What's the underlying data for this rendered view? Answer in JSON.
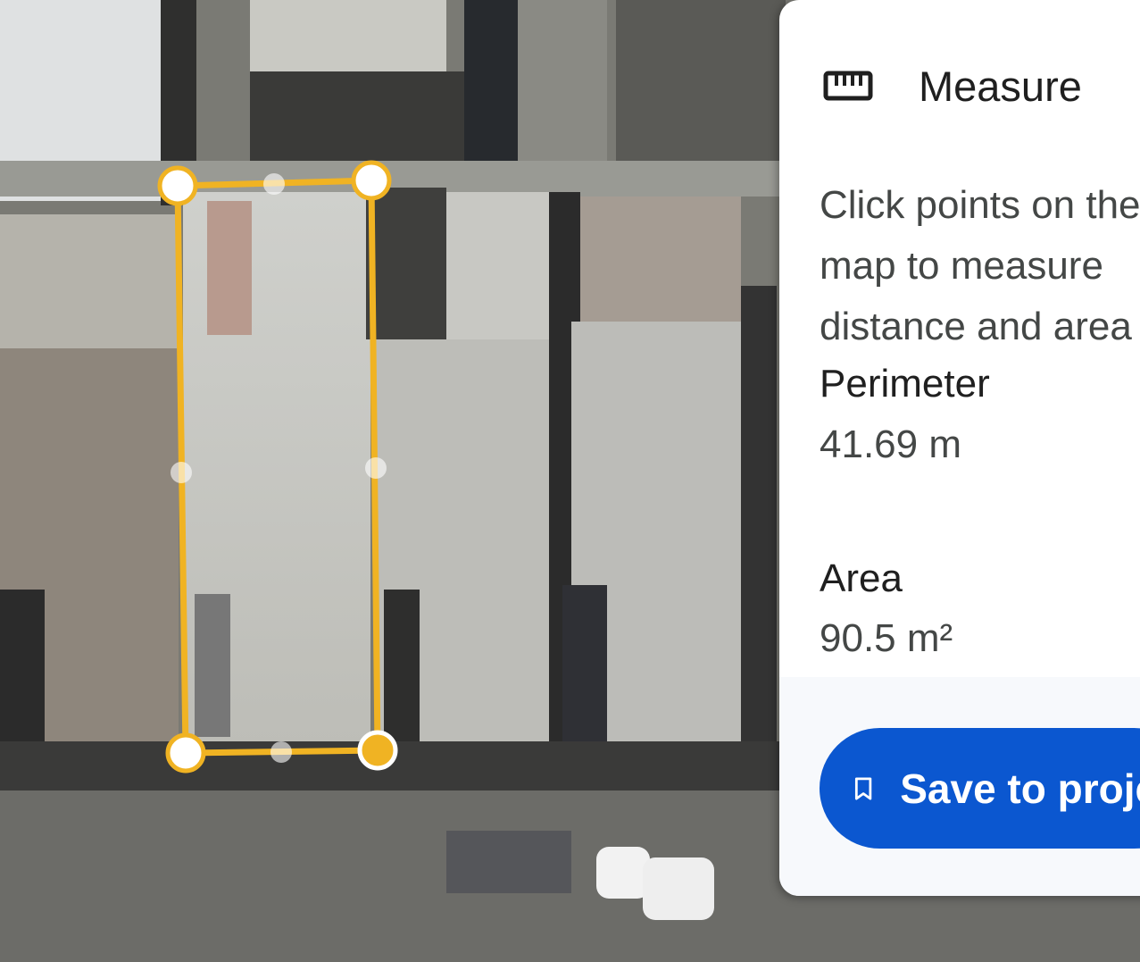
{
  "map": {
    "shape_color": "#f0b323",
    "handle_fill": "#ffffff",
    "active_handle_fill": "#f0b323"
  },
  "panel": {
    "icon": "ruler-icon",
    "title": "Measure",
    "instructions": "Click points on the map to measure distance and area",
    "perimeter": {
      "label": "Perimeter",
      "value": "41.69 m"
    },
    "area": {
      "label": "Area",
      "value": "90.5 m²"
    },
    "save_button": {
      "icon": "bookmark-icon",
      "label": "Save to project"
    },
    "accent_color": "#0b57d0"
  }
}
